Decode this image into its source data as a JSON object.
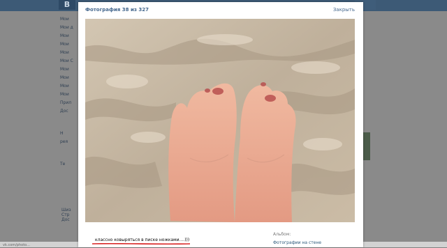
{
  "background": {
    "logo": "В",
    "menu_items": [
      "Мои",
      "Мои д",
      "Мои",
      "Мои",
      "Мои",
      "Мои С",
      "Мои",
      "Мои",
      "Мои",
      "Мои",
      "Прил",
      "Дос"
    ],
    "side_texts": [
      "Н",
      "рея",
      "Те",
      "Шиз",
      "Стр",
      "Дос"
    ],
    "status_bar": "vk.com/photo..."
  },
  "viewer": {
    "title": "Фотография 38 из 327",
    "close_label": "Закрыть",
    "caption": "классно ковыряться в писке ножками....)))",
    "album_label": "Альбом:",
    "album_link": "Фотографии на стене"
  },
  "colors": {
    "link": "#2b587a",
    "caption_underline": "#d82020",
    "overlay": "#7f7f7f"
  }
}
